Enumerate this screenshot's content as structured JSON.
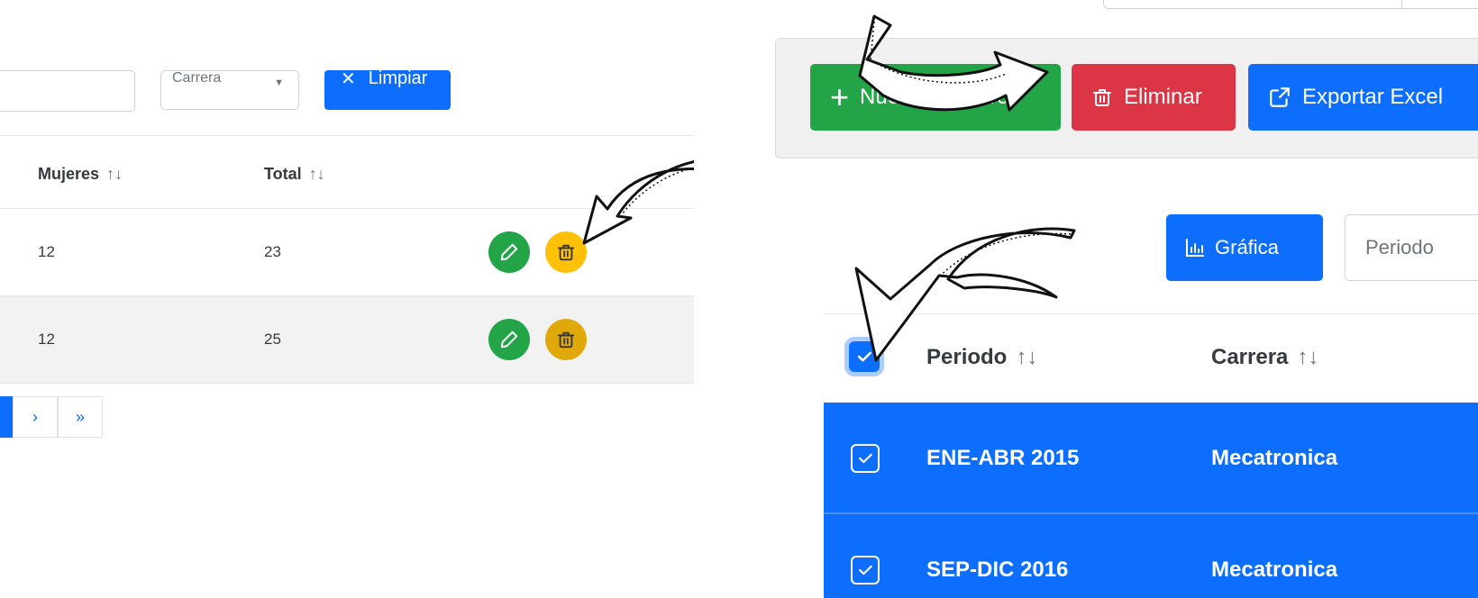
{
  "left": {
    "filters": {
      "dropdown_label": "Carrera",
      "clear_label": "Limpiar"
    },
    "columns": [
      "Mujeres",
      "Total"
    ],
    "rows": [
      {
        "mujeres": "12",
        "total": "23"
      },
      {
        "mujeres": "12",
        "total": "25"
      }
    ],
    "pager": {
      "next": "›",
      "last": "»"
    }
  },
  "right": {
    "toolbar": {
      "new_label": "Nuevo Registro",
      "delete_label": "Eliminar",
      "export_label": "Exportar Excel"
    },
    "graph_label": "Gráfica",
    "period_placeholder": "Periodo",
    "columns": [
      "Periodo",
      "Carrera"
    ],
    "rows": [
      {
        "periodo": "ENE-ABR 2015",
        "carrera": "Mecatronica"
      },
      {
        "periodo": "SEP-DIC 2016",
        "carrera": "Mecatronica"
      }
    ]
  },
  "sort_glyph": "↑↓",
  "colors": {
    "primary": "#0d6efd",
    "success": "#22a447",
    "danger": "#dc3545",
    "warning": "#ffc107"
  }
}
